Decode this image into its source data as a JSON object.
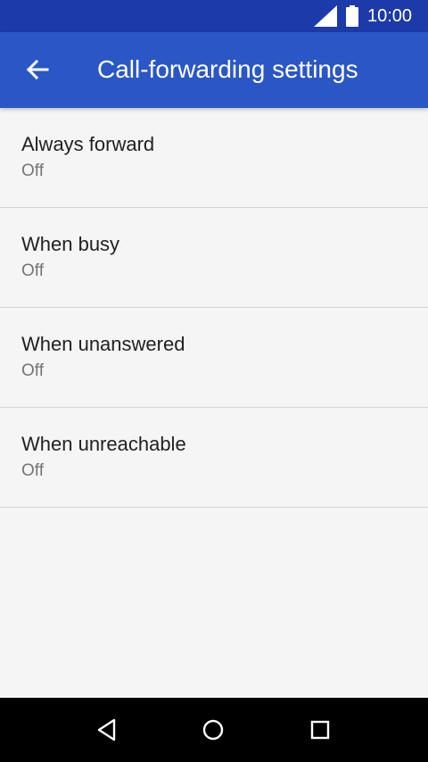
{
  "status_bar": {
    "time": "10:00",
    "icons": [
      "signal-icon",
      "battery-icon"
    ]
  },
  "app_bar": {
    "title": "Call-forwarding settings",
    "back_icon": "arrow-back-icon"
  },
  "settings": [
    {
      "title": "Always forward",
      "summary": "Off"
    },
    {
      "title": "When busy",
      "summary": "Off"
    },
    {
      "title": "When unanswered",
      "summary": "Off"
    },
    {
      "title": "When unreachable",
      "summary": "Off"
    }
  ],
  "nav_bar": {
    "buttons": [
      "back-triangle-icon",
      "home-circle-icon",
      "recents-square-icon"
    ]
  },
  "colors": {
    "status_bar": "#1c3aa9",
    "app_bar": "#2a56c6",
    "background": "#f5f5f5",
    "divider": "#d6d6d6",
    "title_text": "#212121",
    "summary_text": "#757575",
    "nav_bar": "#000000"
  }
}
